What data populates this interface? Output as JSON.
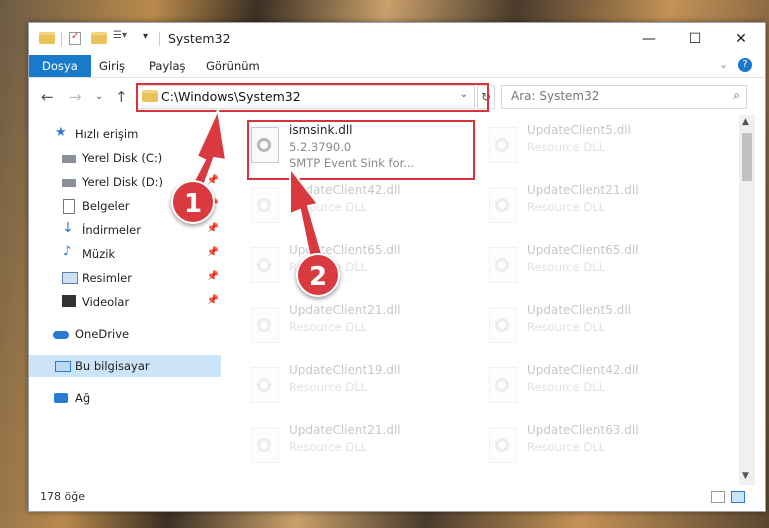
{
  "window": {
    "title": "System32",
    "minimize": "—",
    "maximize": "☐",
    "close": "✕"
  },
  "ribbon": {
    "tabs": [
      "Dosya",
      "Giriş",
      "Paylaş",
      "Görünüm"
    ]
  },
  "address": {
    "path": "C:\\Windows\\System32",
    "search_placeholder": "Ara: System32"
  },
  "sidebar": {
    "items": [
      {
        "label": "Hızlı erişim",
        "icon": "star-icon"
      },
      {
        "label": "Yerel Disk (C:)",
        "icon": "drive-icon",
        "pinned": true
      },
      {
        "label": "Yerel Disk (D:)",
        "icon": "drive-icon",
        "pinned": true
      },
      {
        "label": "Belgeler",
        "icon": "document-icon",
        "pinned": true
      },
      {
        "label": "İndirmeler",
        "icon": "download-icon",
        "pinned": true
      },
      {
        "label": "Müzik",
        "icon": "music-icon",
        "pinned": true
      },
      {
        "label": "Resimler",
        "icon": "pictures-icon",
        "pinned": true
      },
      {
        "label": "Videolar",
        "icon": "video-icon",
        "pinned": true
      },
      {
        "label": "OneDrive",
        "icon": "cloud-icon"
      },
      {
        "label": "Bu bilgisayar",
        "icon": "computer-icon",
        "selected": true
      },
      {
        "label": "Ağ",
        "icon": "network-icon"
      }
    ]
  },
  "files": {
    "highlighted": {
      "name": "ismsink.dll",
      "version": "5.2.3790.0",
      "desc": "SMTP Event Sink for..."
    },
    "others": [
      {
        "name": "UpdateClient5.dll",
        "desc": "Resource DLL"
      },
      {
        "name": "UpdateClient42.dll",
        "desc": "Resource DLL"
      },
      {
        "name": "UpdateClient21.dll",
        "desc": "Resource DLL"
      },
      {
        "name": "UpdateClient65.dll",
        "desc": "Resource DLL"
      },
      {
        "name": "UpdateClient65.dll",
        "desc": "Resource DLL"
      },
      {
        "name": "UpdateClient21.dll",
        "desc": "Resource DLL"
      },
      {
        "name": "UpdateClient5.dll",
        "desc": "Resource DLL"
      },
      {
        "name": "UpdateClient19.dll",
        "desc": "Resource DLL"
      },
      {
        "name": "UpdateClient42.dll",
        "desc": "Resource DLL"
      },
      {
        "name": "UpdateClient21.dll",
        "desc": "Resource DLL"
      },
      {
        "name": "UpdateClient63.dll",
        "desc": "Resource DLL"
      }
    ]
  },
  "status": {
    "count": "178 öğe"
  },
  "annotations": {
    "step1": "1",
    "step2": "2",
    "accent": "#d8333a"
  }
}
